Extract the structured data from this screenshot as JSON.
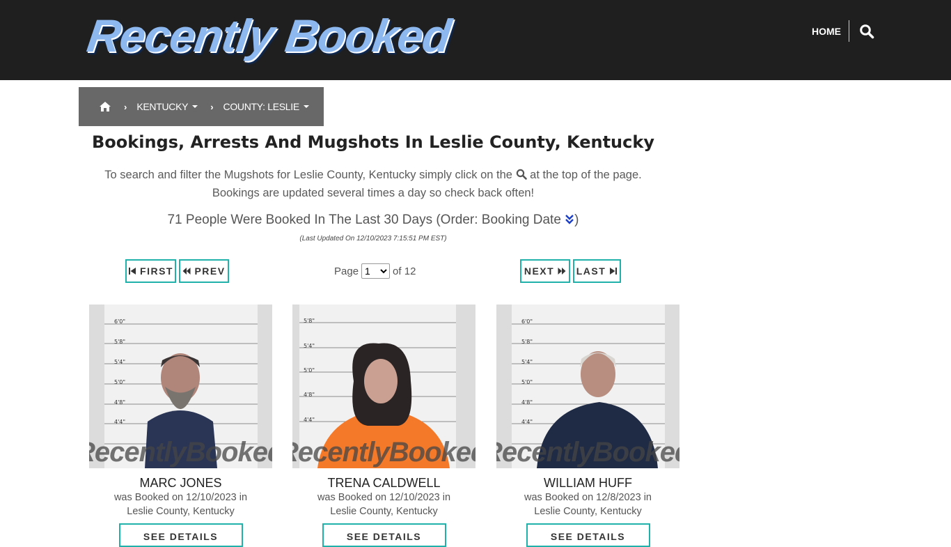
{
  "header": {
    "logo_text": "Recently Booked",
    "nav_home": "HOME",
    "search_icon": "search-icon"
  },
  "breadcrumb": {
    "home_icon": "home-icon",
    "state": "KENTUCKY",
    "county": "COUNTY: LESLIE"
  },
  "main": {
    "title": "Bookings, Arrests And Mugshots In Leslie County, Kentucky",
    "intro_before_icon": "To search and filter the Mugshots for Leslie County, Kentucky simply click on the",
    "intro_after_icon": "at the top of the page.",
    "intro_line2": "Bookings are updated several times a day so check back often!",
    "count_text": "71 People Were Booked In The Last 30 Days (Order: Booking Date",
    "count_close": ")",
    "last_updated": "(Last Updated On 12/10/2023 7:15:51 PM EST)"
  },
  "pager": {
    "first": "FIRST",
    "prev": "PREV",
    "next": "NEXT",
    "last": "LAST",
    "page_label": "Page",
    "current_page": "1",
    "of_label": "of 12"
  },
  "bookings": [
    {
      "name": "MARC JONES",
      "booked_line": "was Booked on 12/10/2023 in",
      "location": "Leslie County, Kentucky",
      "details_label": "SEE DETAILS",
      "clothing": "#2a3555"
    },
    {
      "name": "TRENA CALDWELL",
      "booked_line": "was Booked on 12/10/2023 in",
      "location": "Leslie County, Kentucky",
      "details_label": "SEE DETAILS",
      "clothing": "#f47a2a"
    },
    {
      "name": "WILLIAM HUFF",
      "booked_line": "was Booked on 12/8/2023 in",
      "location": "Leslie County, Kentucky",
      "details_label": "SEE DETAILS",
      "clothing": "#1f2a44"
    }
  ],
  "watermark": "RecentlyBooked.com",
  "colors": {
    "header_bg": "#1f1f1f",
    "breadcrumb_bg": "#686868",
    "button_border": "#20b2aa",
    "order_arrow": "#1a3ec8"
  }
}
